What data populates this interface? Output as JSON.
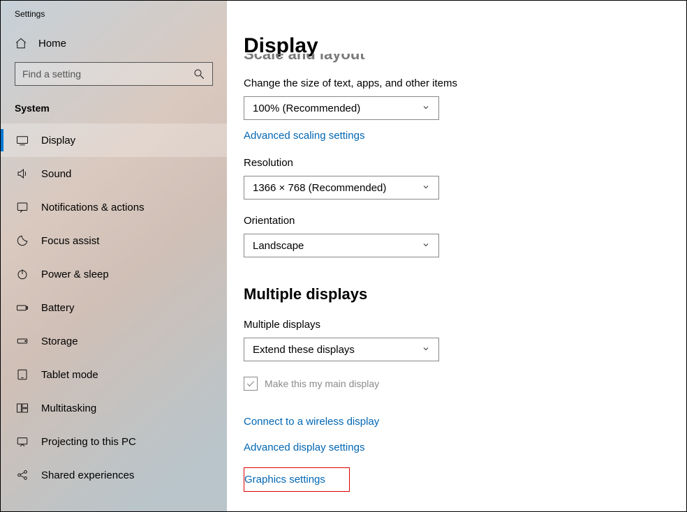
{
  "window": {
    "title": "Settings"
  },
  "sidebar": {
    "home": "Home",
    "search_placeholder": "Find a setting",
    "section": "System",
    "items": [
      {
        "label": "Display"
      },
      {
        "label": "Sound"
      },
      {
        "label": "Notifications & actions"
      },
      {
        "label": "Focus assist"
      },
      {
        "label": "Power & sleep"
      },
      {
        "label": "Battery"
      },
      {
        "label": "Storage"
      },
      {
        "label": "Tablet mode"
      },
      {
        "label": "Multitasking"
      },
      {
        "label": "Projecting to this PC"
      },
      {
        "label": "Shared experiences"
      }
    ]
  },
  "main": {
    "title": "Display",
    "cutoff_section": "Scale and layout",
    "scale": {
      "label": "Change the size of text, apps, and other items",
      "value": "100% (Recommended)",
      "advanced_link": "Advanced scaling settings"
    },
    "resolution": {
      "label": "Resolution",
      "value": "1366 × 768 (Recommended)"
    },
    "orientation": {
      "label": "Orientation",
      "value": "Landscape"
    },
    "multiple": {
      "heading": "Multiple displays",
      "label": "Multiple displays",
      "value": "Extend these displays",
      "checkbox_label": "Make this my main display",
      "checkbox_checked": true,
      "checkbox_disabled": true
    },
    "links": {
      "connect_wireless": "Connect to a wireless display",
      "advanced_display": "Advanced display settings",
      "graphics": "Graphics settings"
    }
  }
}
